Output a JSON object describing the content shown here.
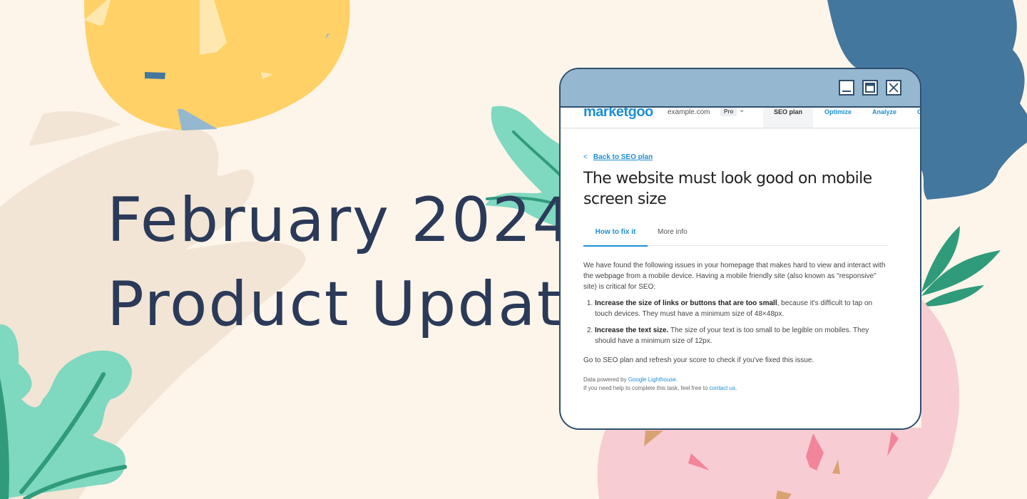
{
  "headline": {
    "line1": "February 2024",
    "line2": "Product Update"
  },
  "colors": {
    "background": "#fdf5ea",
    "headline": "#2b3a58",
    "accent": "#1d8fd6",
    "titlebar": "#95b7d0",
    "window_border": "#2f4f6e"
  },
  "window": {
    "controls": {
      "minimize_icon": "minimize-icon",
      "maximize_icon": "maximize-icon",
      "close_icon": "close-icon"
    }
  },
  "navbar": {
    "logo": "marketgoo",
    "domain": "example.com",
    "plan": "Pro",
    "dropdown_icon": "chevron-down-icon",
    "items": [
      {
        "label": "SEO plan",
        "active": true
      },
      {
        "label": "Optimize",
        "active": false
      },
      {
        "label": "Analyze",
        "active": false
      },
      {
        "label": "C",
        "active": false
      }
    ]
  },
  "page": {
    "back_link": "Back to SEO plan",
    "back_icon": "chevron-left-icon",
    "title": "The website must look good on mobile screen size",
    "tabs": [
      {
        "label": "How to fix it",
        "active": true
      },
      {
        "label": "More info",
        "active": false
      }
    ],
    "intro": "We have found the following issues in your homepage that makes hard to view and interact with the webpage from a mobile device. Having a mobile friendly site (also known as \"responsive\" site) is critical for SEO:",
    "issues": [
      {
        "bold": "Increase the size of links or buttons that are too small",
        "text": ", because it's difficult to tap on touch devices. They must have a minimum size of 48×48px."
      },
      {
        "bold": "Increase the text size.",
        "text": " The size of your text is too small to be legible on mobiles. They should have a minimum size of 12px."
      }
    ],
    "refresh_note": "Go to SEO plan and refresh your score to check if you've fixed this issue.",
    "footer": {
      "powered_prefix": "Data powered by ",
      "powered_link": "Google Lighthouse",
      "powered_suffix": ".",
      "help_prefix": "If you need help to complete this task, feel free to ",
      "help_link": "contact us",
      "help_suffix": "."
    }
  }
}
